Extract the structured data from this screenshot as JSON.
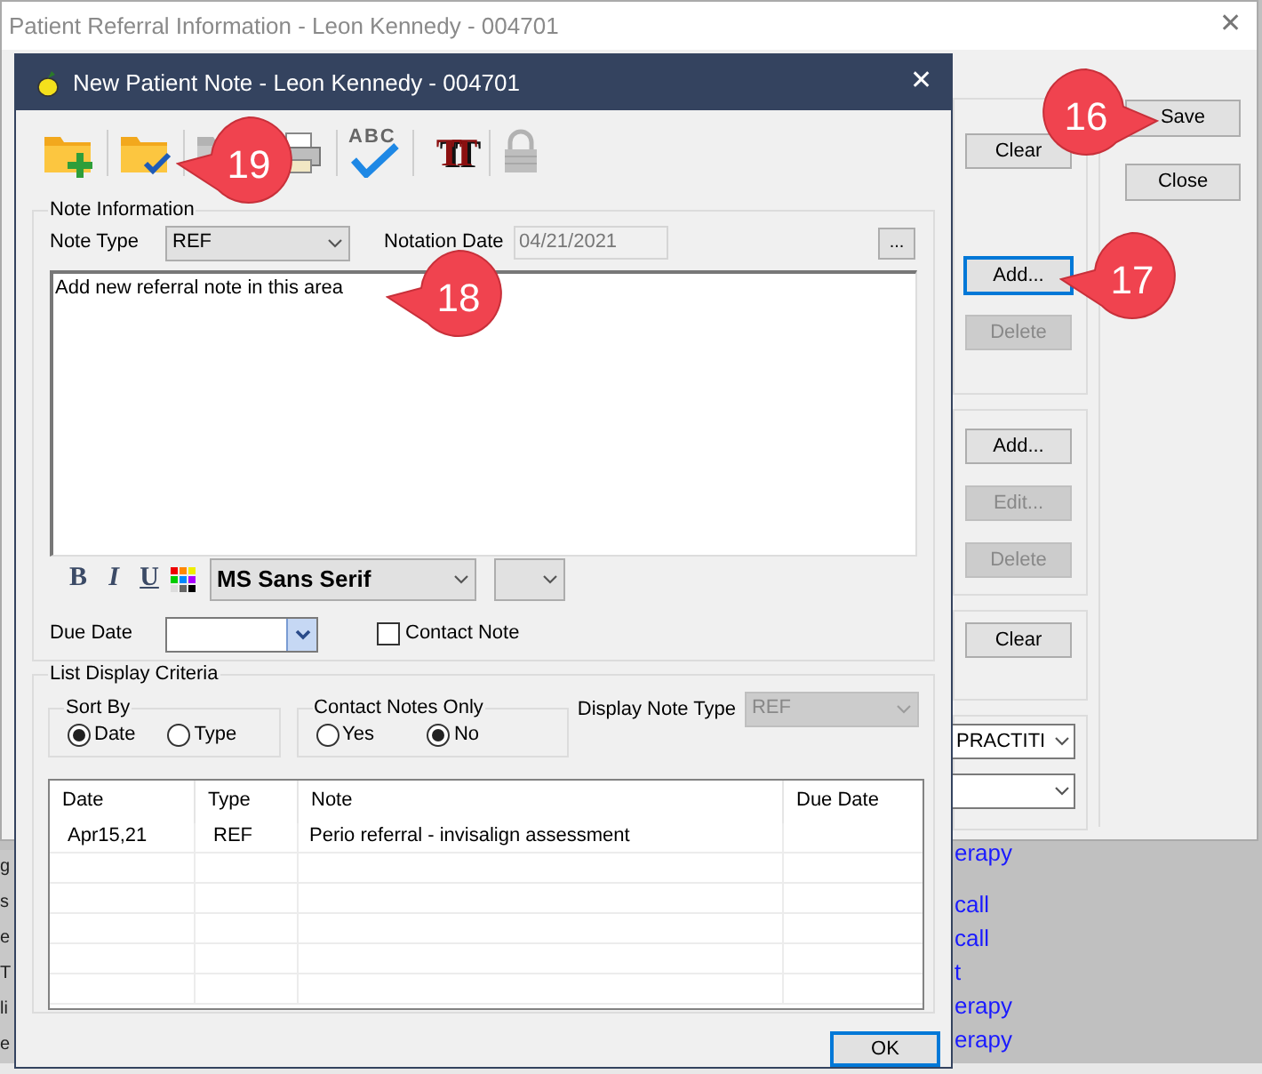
{
  "background_window": {
    "title": "Patient Referral Information - Leon Kennedy - 004701",
    "close": "✕",
    "groups": [
      {
        "buttons": [
          {
            "label": "Clear",
            "disabled": false,
            "focused": false,
            "kind": "top"
          },
          {
            "label": "Add...",
            "disabled": false,
            "focused": true,
            "kind": "mid"
          },
          {
            "label": "Delete",
            "disabled": true,
            "focused": false,
            "kind": "next"
          }
        ]
      },
      {
        "buttons": [
          {
            "label": "Add...",
            "disabled": false,
            "focused": false,
            "kind": "top"
          },
          {
            "label": "Edit...",
            "disabled": true,
            "focused": false,
            "kind": "next"
          },
          {
            "label": "Delete",
            "disabled": true,
            "focused": false,
            "kind": "next"
          }
        ]
      },
      {
        "buttons": [
          {
            "label": "Clear",
            "disabled": false,
            "focused": false,
            "kind": "top"
          }
        ]
      }
    ],
    "selectors": [
      {
        "kind": "text",
        "value": "PRACTITI"
      },
      {
        "kind": "blank"
      }
    ],
    "side_buttons": [
      "Save",
      "Close"
    ]
  },
  "behind_text": {
    "left": [
      "g",
      "s",
      "e",
      "T",
      "li",
      "e"
    ],
    "right": [
      "erapy",
      "call",
      "call",
      "t",
      "erapy",
      "erapy"
    ]
  },
  "dialog": {
    "title": "New Patient Note - Leon Kennedy - 004701",
    "close": "✕",
    "toolbar": [
      {
        "kind": "folder-add",
        "disabled": false
      },
      {
        "kind": "folder-check",
        "disabled": false
      },
      {
        "kind": "folder",
        "disabled": true
      },
      {
        "kind": "printer",
        "disabled": false
      },
      {
        "kind": "spell",
        "label": "ABC",
        "disabled": false
      },
      {
        "kind": "font",
        "label": "TT",
        "disabled": false
      },
      {
        "kind": "lock",
        "disabled": true
      }
    ],
    "note_information": {
      "legend": "Note Information",
      "note_type_label": "Note Type",
      "note_type": "REF",
      "notation_date_label": "Notation Date",
      "notation_date": "04/21/2021",
      "ellipsis": "...",
      "note_text": "Add new referral note in this area",
      "format_buttons": [
        "B",
        "I",
        "U"
      ],
      "font": "MS Sans Serif",
      "due_date_label": "Due Date",
      "contact_note": {
        "label": "Contact Note",
        "checked": false
      }
    },
    "list_display_criteria": {
      "legend": "List Display Criteria",
      "sort_by": {
        "legend": "Sort By",
        "options": [
          {
            "label": "Date",
            "selected": true
          },
          {
            "label": "Type",
            "selected": false
          }
        ]
      },
      "contact_notes_only": {
        "legend": "Contact Notes Only",
        "options": [
          {
            "label": "Yes",
            "selected": false
          },
          {
            "label": "No",
            "selected": true
          }
        ]
      },
      "display_note_type_label": "Display Note Type",
      "display_note_type": "REF"
    },
    "table": {
      "columns": [
        "Date",
        "Type",
        "Note",
        "Due Date"
      ],
      "rows": [
        [
          "Apr15,21",
          "REF",
          "Perio referral - invisalign assessment",
          null
        ]
      ]
    },
    "ok_button": "OK"
  },
  "callouts": [
    {
      "label": "16"
    },
    {
      "label": "17"
    },
    {
      "label": "18"
    },
    {
      "label": "19"
    }
  ]
}
